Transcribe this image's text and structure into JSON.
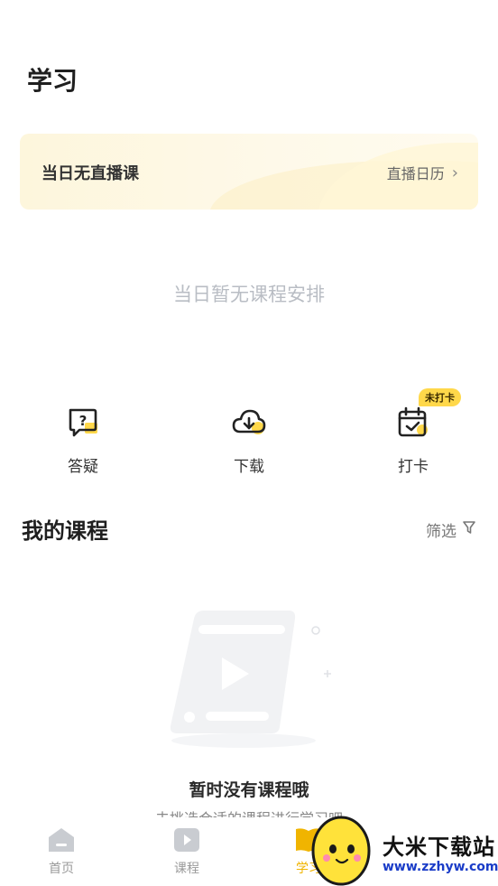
{
  "header": {
    "title": "学习"
  },
  "live_banner": {
    "no_live_text": "当日无直播课",
    "calendar_link": "直播日历"
  },
  "schedule": {
    "empty_text": "当日暂无课程安排"
  },
  "quick_actions": [
    {
      "label": "答疑",
      "icon": "question-chat-icon"
    },
    {
      "label": "下载",
      "icon": "cloud-download-icon"
    },
    {
      "label": "打卡",
      "icon": "calendar-check-icon",
      "badge": "未打卡"
    }
  ],
  "my_courses": {
    "title": "我的课程",
    "filter_label": "筛选",
    "empty_title": "暂时没有课程哦",
    "empty_subtitle": "去挑选合适的课程进行学习吧"
  },
  "tabbar": {
    "items": [
      {
        "label": "首页",
        "icon": "home-icon",
        "active": false
      },
      {
        "label": "课程",
        "icon": "video-icon",
        "active": false
      },
      {
        "label": "学习",
        "icon": "book-icon",
        "active": true
      }
    ]
  },
  "watermark": {
    "name": "大米下载站",
    "url": "www.zzhyw.com"
  },
  "colors": {
    "accent": "#f0b400",
    "badge": "#ffd84a",
    "banner_bg": "#fdf6dc",
    "muted_text": "#b9bdc4"
  }
}
